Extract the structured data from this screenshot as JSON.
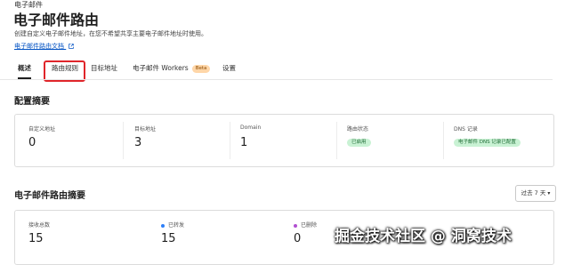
{
  "breadcrumb": "电子邮件",
  "title": "电子邮件路由",
  "description": "创建自定义电子邮件地址，在您不希望共享主要电子邮件地址时使用。",
  "doc_link": "电子邮件路由文档",
  "tabs": [
    {
      "label": "概述",
      "active": true
    },
    {
      "label": "路由规则",
      "highlighted": true
    },
    {
      "label": "目标地址"
    },
    {
      "label": "电子邮件 Workers",
      "badge": "Beta"
    },
    {
      "label": "设置"
    }
  ],
  "config_summary": {
    "title": "配置摘要",
    "stats": [
      {
        "label": "自定义地址",
        "value": "0"
      },
      {
        "label": "目标地址",
        "value": "3"
      },
      {
        "label": "Domain",
        "value": "1"
      },
      {
        "label": "路由状态",
        "status": "已启用"
      },
      {
        "label": "DNS 记录",
        "status": "电子邮件 DNS 记录已配置"
      }
    ]
  },
  "routing_summary": {
    "title": "电子邮件路由摘要",
    "range": "过去 7 天",
    "stats": [
      {
        "label": "接收总数",
        "value": "15"
      },
      {
        "label": "已转发",
        "value": "15",
        "dot_color": "#2d7ff9"
      },
      {
        "label": "已删除",
        "value": "0",
        "dot_color": "#b14fd1"
      }
    ]
  },
  "watermark": "掘金技术社区 @ 洞窝技术",
  "colors": {
    "accent": "#0051c3",
    "highlight": "#e0252a",
    "status_green": "#c9f2d4",
    "beta": "#ffd6a8"
  }
}
